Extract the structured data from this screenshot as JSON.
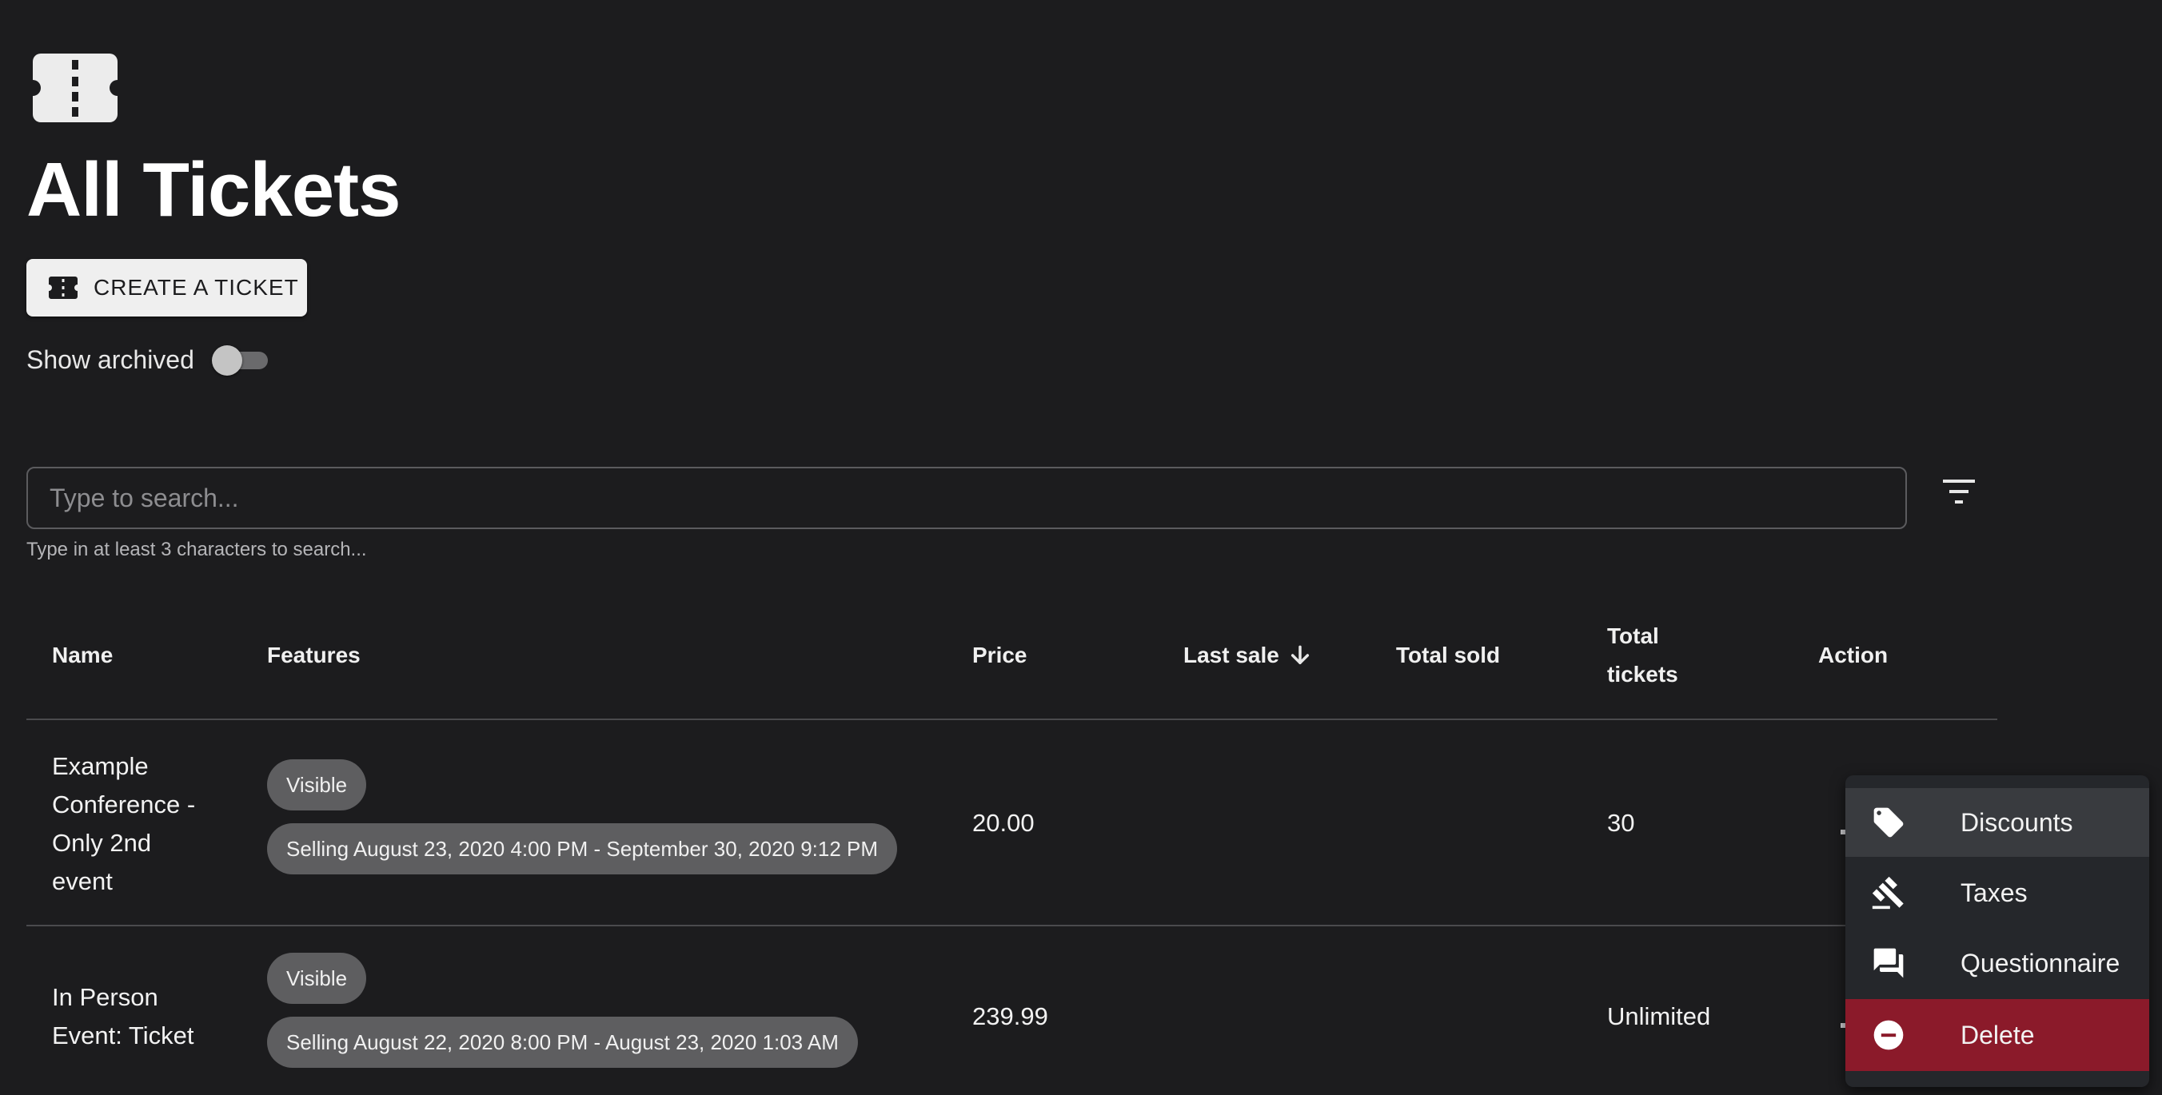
{
  "page": {
    "title": "All Tickets"
  },
  "actions": {
    "create_label": "CREATE A TICKET"
  },
  "archived": {
    "label": "Show archived",
    "checked": false
  },
  "search": {
    "placeholder": "Type to search...",
    "value": "",
    "helper": "Type in at least 3 characters to search..."
  },
  "table": {
    "headers": {
      "name": "Name",
      "features": "Features",
      "price": "Price",
      "last_sale": "Last sale",
      "total_sold": "Total sold",
      "total_tickets_1": "Total",
      "total_tickets_2": "tickets",
      "action": "Action"
    },
    "sort": {
      "column": "last_sale",
      "direction": "descending"
    },
    "rows": [
      {
        "name_lines": [
          "Example",
          "Conference -",
          "Only 2nd",
          "event"
        ],
        "chips": [
          "Visible",
          "Selling August 23, 2020 4:00 PM - September 30, 2020 9:12 PM"
        ],
        "price": "20.00",
        "last_sale": "",
        "total_sold": "",
        "total_tickets": "30"
      },
      {
        "name_lines": [
          "In Person",
          "Event: Ticket"
        ],
        "chips": [
          "Visible",
          "Selling August 22, 2020 8:00 PM - August 23, 2020 1:03 AM"
        ],
        "price": "239.99",
        "last_sale": "",
        "total_sold": "",
        "total_tickets": "Unlimited"
      }
    ]
  },
  "menu": {
    "items": [
      {
        "label": "Discounts",
        "icon": "tag-icon",
        "highlighted": true
      },
      {
        "label": "Taxes",
        "icon": "gavel-icon"
      },
      {
        "label": "Questionnaire",
        "icon": "forum-icon"
      },
      {
        "label": "Delete",
        "icon": "remove-circle-icon",
        "danger": true
      }
    ]
  },
  "colors": {
    "background": "#1c1c1e",
    "menu_background": "#25272b",
    "menu_highlight": "#393b3f",
    "danger": "#8b1a2a",
    "chip": "#5e5e60"
  }
}
